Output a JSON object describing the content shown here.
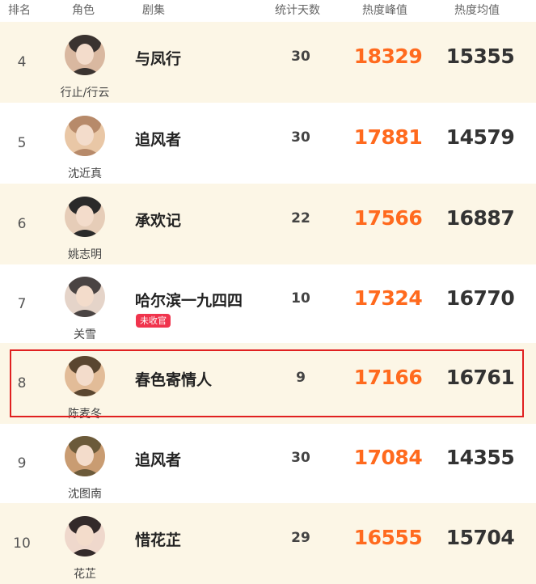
{
  "header": {
    "rank": "排名",
    "role": "角色",
    "drama": "剧集",
    "days": "统计天数",
    "peak": "热度峰值",
    "avg": "热度均值"
  },
  "rows": [
    {
      "rank": "4",
      "role": "行止/行云",
      "drama": "与凤行",
      "days": "30",
      "peak": "18329",
      "avg": "15355",
      "badge": ""
    },
    {
      "rank": "5",
      "role": "沈近真",
      "drama": "追风者",
      "days": "30",
      "peak": "17881",
      "avg": "14579",
      "badge": ""
    },
    {
      "rank": "6",
      "role": "姚志明",
      "drama": "承欢记",
      "days": "22",
      "peak": "17566",
      "avg": "16887",
      "badge": ""
    },
    {
      "rank": "7",
      "role": "关雪",
      "drama": "哈尔滨一九四四",
      "days": "10",
      "peak": "17324",
      "avg": "16770",
      "badge": "未收官"
    },
    {
      "rank": "8",
      "role": "陈麦冬",
      "drama": "春色寄情人",
      "days": "9",
      "peak": "17166",
      "avg": "16761",
      "badge": ""
    },
    {
      "rank": "9",
      "role": "沈图南",
      "drama": "追风者",
      "days": "30",
      "peak": "17084",
      "avg": "14355",
      "badge": ""
    },
    {
      "rank": "10",
      "role": "花芷",
      "drama": "惜花芷",
      "days": "29",
      "peak": "16555",
      "avg": "15704",
      "badge": ""
    }
  ],
  "colors": {
    "alt_row_bg": "#fcf6e6",
    "peak_text": "#ff6a1e",
    "badge_bg": "#f0344d",
    "highlight_border": "#e02020"
  }
}
